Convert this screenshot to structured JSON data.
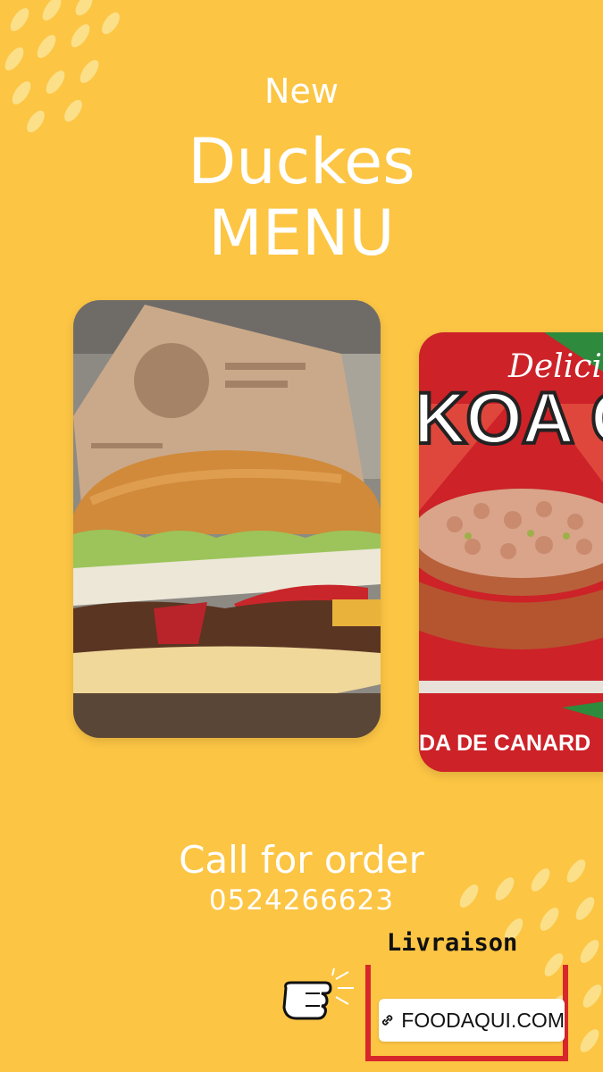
{
  "story": {
    "title_line1": "New",
    "title_line2": "Duckes",
    "title_line3": "MENU",
    "call_text": "Call for order",
    "phone": "0524266623",
    "delivery_label": "Livraison",
    "link_sticker": {
      "text": "FOODAQUI.COM",
      "icon": "link-icon"
    },
    "pointer_icon": "pointing-hand-icon"
  },
  "cards": [
    {
      "name": "duck burger photo"
    },
    {
      "name": "dish promo",
      "script_text": "Delici",
      "headline": "KOA CA",
      "caption": "DA DE CANARD"
    }
  ],
  "colors": {
    "background": "#fcc544",
    "accent": "#d8272a",
    "text": "#ffffff"
  }
}
